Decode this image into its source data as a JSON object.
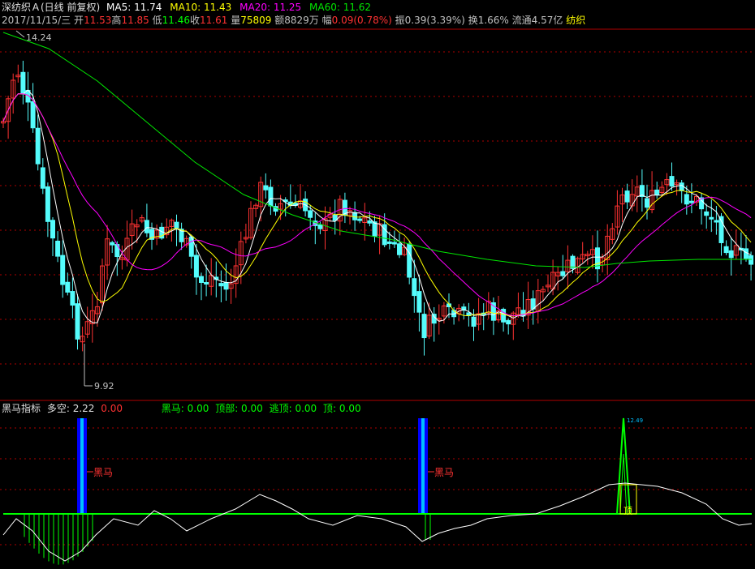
{
  "colors": {
    "up": "#ff3232",
    "down": "#54fcfc",
    "ma5": "#ffffff",
    "ma10": "#ffff00",
    "ma20": "#ff00ff",
    "ma60": "#00e600",
    "grid": "#b00000",
    "blackhorse_bar": "#0000ff",
    "blackhorse_core": "#00bfff",
    "indicator_line": "#ffffff",
    "zero_line": "#00ff00"
  },
  "header": {
    "stock": "深纺织Ａ(日线 前复权)",
    "ma5_label": "MA5: 11.74",
    "ma10_label": "MA10: 11.43",
    "ma20_label": "MA20: 11.25",
    "ma60_label": "MA60: 11.62"
  },
  "quote": {
    "date": "2017/11/15/三",
    "open_label": "开",
    "open": "11.53",
    "high_label": "高",
    "high": "11.85",
    "low_label": "低",
    "low": "11.46",
    "close_label": "收",
    "close": "11.61",
    "volume_label": "量",
    "volume": "75809",
    "amount": "额8829万",
    "change_label": "幅",
    "change": "0.09(0.78%)",
    "amplitude": "振0.39(3.39%)",
    "turnover": "换1.66%",
    "float_cap": "流通4.57亿",
    "industry": "纺织"
  },
  "price_chart": {
    "high_marker": "14.24",
    "low_marker": "9.92"
  },
  "indicator": {
    "name": "黑马指标",
    "duokong": "多空: 2.22",
    "duokong_val2": "0.00",
    "heima": "黑马: 0.00",
    "dingbu": "顶部: 0.00",
    "taoding": "逃顶: 0.00",
    "ding": "顶: 0.00",
    "heima_marker": "黑马",
    "top_marker": "顶",
    "peak_value": "12.49"
  }
}
